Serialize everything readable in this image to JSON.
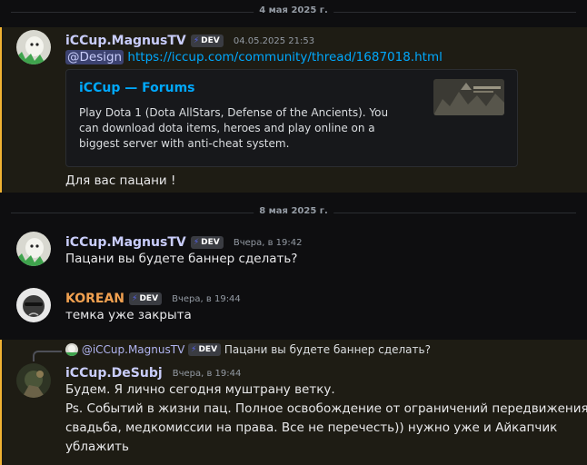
{
  "dividers": {
    "date1": "4 мая 2025 г.",
    "date2": "8 мая 2025 г."
  },
  "colors": {
    "accent": "#5865f2",
    "mention_bar": "#f0b232",
    "link": "#00a8fc",
    "korean_name": "#f0a050"
  },
  "messages": [
    {
      "author": "iCCup.MagnusTV",
      "badge": "DEV",
      "timestamp": "04.05.2025 21:53",
      "mention": "@Design",
      "link": "https://iccup.com/community/thread/1687018.html",
      "embed": {
        "title": "iCCup — Forums",
        "description": "Play Dota 1 (Dota AllStars, Defense of the Ancients). You can download dota items, heroes and play online on a biggest server with anti-cheat system."
      },
      "text": "Для вас пацани !"
    },
    {
      "author": "iCCup.MagnusTV",
      "badge": "DEV",
      "timestamp": "Вчера, в 19:42",
      "text": "Пацани вы будете баннер сделать?"
    },
    {
      "author": "KOREAN",
      "badge": "DEV",
      "timestamp": "Вчера, в 19:44",
      "text": "темка уже закрыта"
    },
    {
      "reply": {
        "author": "@iCCup.MagnusTV",
        "badge": "DEV",
        "text": "Пацани вы будете баннер сделать?"
      },
      "author": "iCCup.DeSubj",
      "timestamp": "Вчера, в 19:44",
      "lines": [
        "Будем. Я лично сегодня муштрану ветку.",
        "Ps. Событий в жизни пац. Полное освобождение от ограничений передвижения,",
        "свадьба, медкомиссии на права. Все не перечесть)) нужно уже и Айкапчик",
        "ублажить"
      ]
    }
  ]
}
